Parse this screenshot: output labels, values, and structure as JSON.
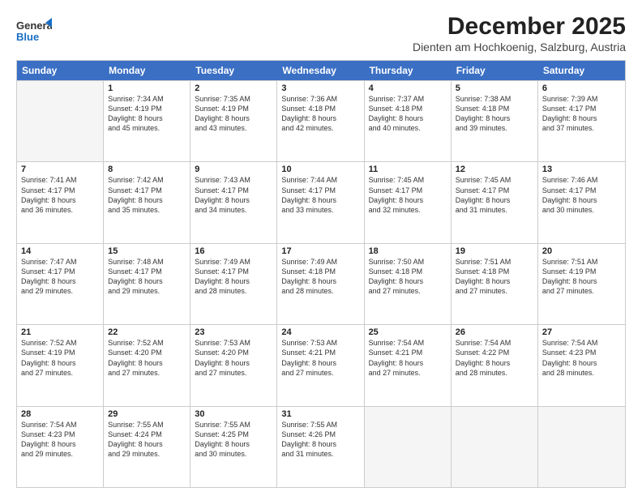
{
  "logo": {
    "general": "General",
    "blue": "Blue"
  },
  "title": "December 2025",
  "subtitle": "Dienten am Hochkoenig, Salzburg, Austria",
  "header_days": [
    "Sunday",
    "Monday",
    "Tuesday",
    "Wednesday",
    "Thursday",
    "Friday",
    "Saturday"
  ],
  "weeks": [
    [
      {
        "day": "",
        "info": "",
        "empty": true
      },
      {
        "day": "1",
        "info": "Sunrise: 7:34 AM\nSunset: 4:19 PM\nDaylight: 8 hours\nand 45 minutes."
      },
      {
        "day": "2",
        "info": "Sunrise: 7:35 AM\nSunset: 4:19 PM\nDaylight: 8 hours\nand 43 minutes."
      },
      {
        "day": "3",
        "info": "Sunrise: 7:36 AM\nSunset: 4:18 PM\nDaylight: 8 hours\nand 42 minutes."
      },
      {
        "day": "4",
        "info": "Sunrise: 7:37 AM\nSunset: 4:18 PM\nDaylight: 8 hours\nand 40 minutes."
      },
      {
        "day": "5",
        "info": "Sunrise: 7:38 AM\nSunset: 4:18 PM\nDaylight: 8 hours\nand 39 minutes."
      },
      {
        "day": "6",
        "info": "Sunrise: 7:39 AM\nSunset: 4:17 PM\nDaylight: 8 hours\nand 37 minutes."
      }
    ],
    [
      {
        "day": "7",
        "info": "Sunrise: 7:41 AM\nSunset: 4:17 PM\nDaylight: 8 hours\nand 36 minutes."
      },
      {
        "day": "8",
        "info": "Sunrise: 7:42 AM\nSunset: 4:17 PM\nDaylight: 8 hours\nand 35 minutes."
      },
      {
        "day": "9",
        "info": "Sunrise: 7:43 AM\nSunset: 4:17 PM\nDaylight: 8 hours\nand 34 minutes."
      },
      {
        "day": "10",
        "info": "Sunrise: 7:44 AM\nSunset: 4:17 PM\nDaylight: 8 hours\nand 33 minutes."
      },
      {
        "day": "11",
        "info": "Sunrise: 7:45 AM\nSunset: 4:17 PM\nDaylight: 8 hours\nand 32 minutes."
      },
      {
        "day": "12",
        "info": "Sunrise: 7:45 AM\nSunset: 4:17 PM\nDaylight: 8 hours\nand 31 minutes."
      },
      {
        "day": "13",
        "info": "Sunrise: 7:46 AM\nSunset: 4:17 PM\nDaylight: 8 hours\nand 30 minutes."
      }
    ],
    [
      {
        "day": "14",
        "info": "Sunrise: 7:47 AM\nSunset: 4:17 PM\nDaylight: 8 hours\nand 29 minutes."
      },
      {
        "day": "15",
        "info": "Sunrise: 7:48 AM\nSunset: 4:17 PM\nDaylight: 8 hours\nand 29 minutes."
      },
      {
        "day": "16",
        "info": "Sunrise: 7:49 AM\nSunset: 4:17 PM\nDaylight: 8 hours\nand 28 minutes."
      },
      {
        "day": "17",
        "info": "Sunrise: 7:49 AM\nSunset: 4:18 PM\nDaylight: 8 hours\nand 28 minutes."
      },
      {
        "day": "18",
        "info": "Sunrise: 7:50 AM\nSunset: 4:18 PM\nDaylight: 8 hours\nand 27 minutes."
      },
      {
        "day": "19",
        "info": "Sunrise: 7:51 AM\nSunset: 4:18 PM\nDaylight: 8 hours\nand 27 minutes."
      },
      {
        "day": "20",
        "info": "Sunrise: 7:51 AM\nSunset: 4:19 PM\nDaylight: 8 hours\nand 27 minutes."
      }
    ],
    [
      {
        "day": "21",
        "info": "Sunrise: 7:52 AM\nSunset: 4:19 PM\nDaylight: 8 hours\nand 27 minutes."
      },
      {
        "day": "22",
        "info": "Sunrise: 7:52 AM\nSunset: 4:20 PM\nDaylight: 8 hours\nand 27 minutes."
      },
      {
        "day": "23",
        "info": "Sunrise: 7:53 AM\nSunset: 4:20 PM\nDaylight: 8 hours\nand 27 minutes."
      },
      {
        "day": "24",
        "info": "Sunrise: 7:53 AM\nSunset: 4:21 PM\nDaylight: 8 hours\nand 27 minutes."
      },
      {
        "day": "25",
        "info": "Sunrise: 7:54 AM\nSunset: 4:21 PM\nDaylight: 8 hours\nand 27 minutes."
      },
      {
        "day": "26",
        "info": "Sunrise: 7:54 AM\nSunset: 4:22 PM\nDaylight: 8 hours\nand 28 minutes."
      },
      {
        "day": "27",
        "info": "Sunrise: 7:54 AM\nSunset: 4:23 PM\nDaylight: 8 hours\nand 28 minutes."
      }
    ],
    [
      {
        "day": "28",
        "info": "Sunrise: 7:54 AM\nSunset: 4:23 PM\nDaylight: 8 hours\nand 29 minutes."
      },
      {
        "day": "29",
        "info": "Sunrise: 7:55 AM\nSunset: 4:24 PM\nDaylight: 8 hours\nand 29 minutes."
      },
      {
        "day": "30",
        "info": "Sunrise: 7:55 AM\nSunset: 4:25 PM\nDaylight: 8 hours\nand 30 minutes."
      },
      {
        "day": "31",
        "info": "Sunrise: 7:55 AM\nSunset: 4:26 PM\nDaylight: 8 hours\nand 31 minutes."
      },
      {
        "day": "",
        "info": "",
        "empty": true
      },
      {
        "day": "",
        "info": "",
        "empty": true
      },
      {
        "day": "",
        "info": "",
        "empty": true
      }
    ]
  ]
}
